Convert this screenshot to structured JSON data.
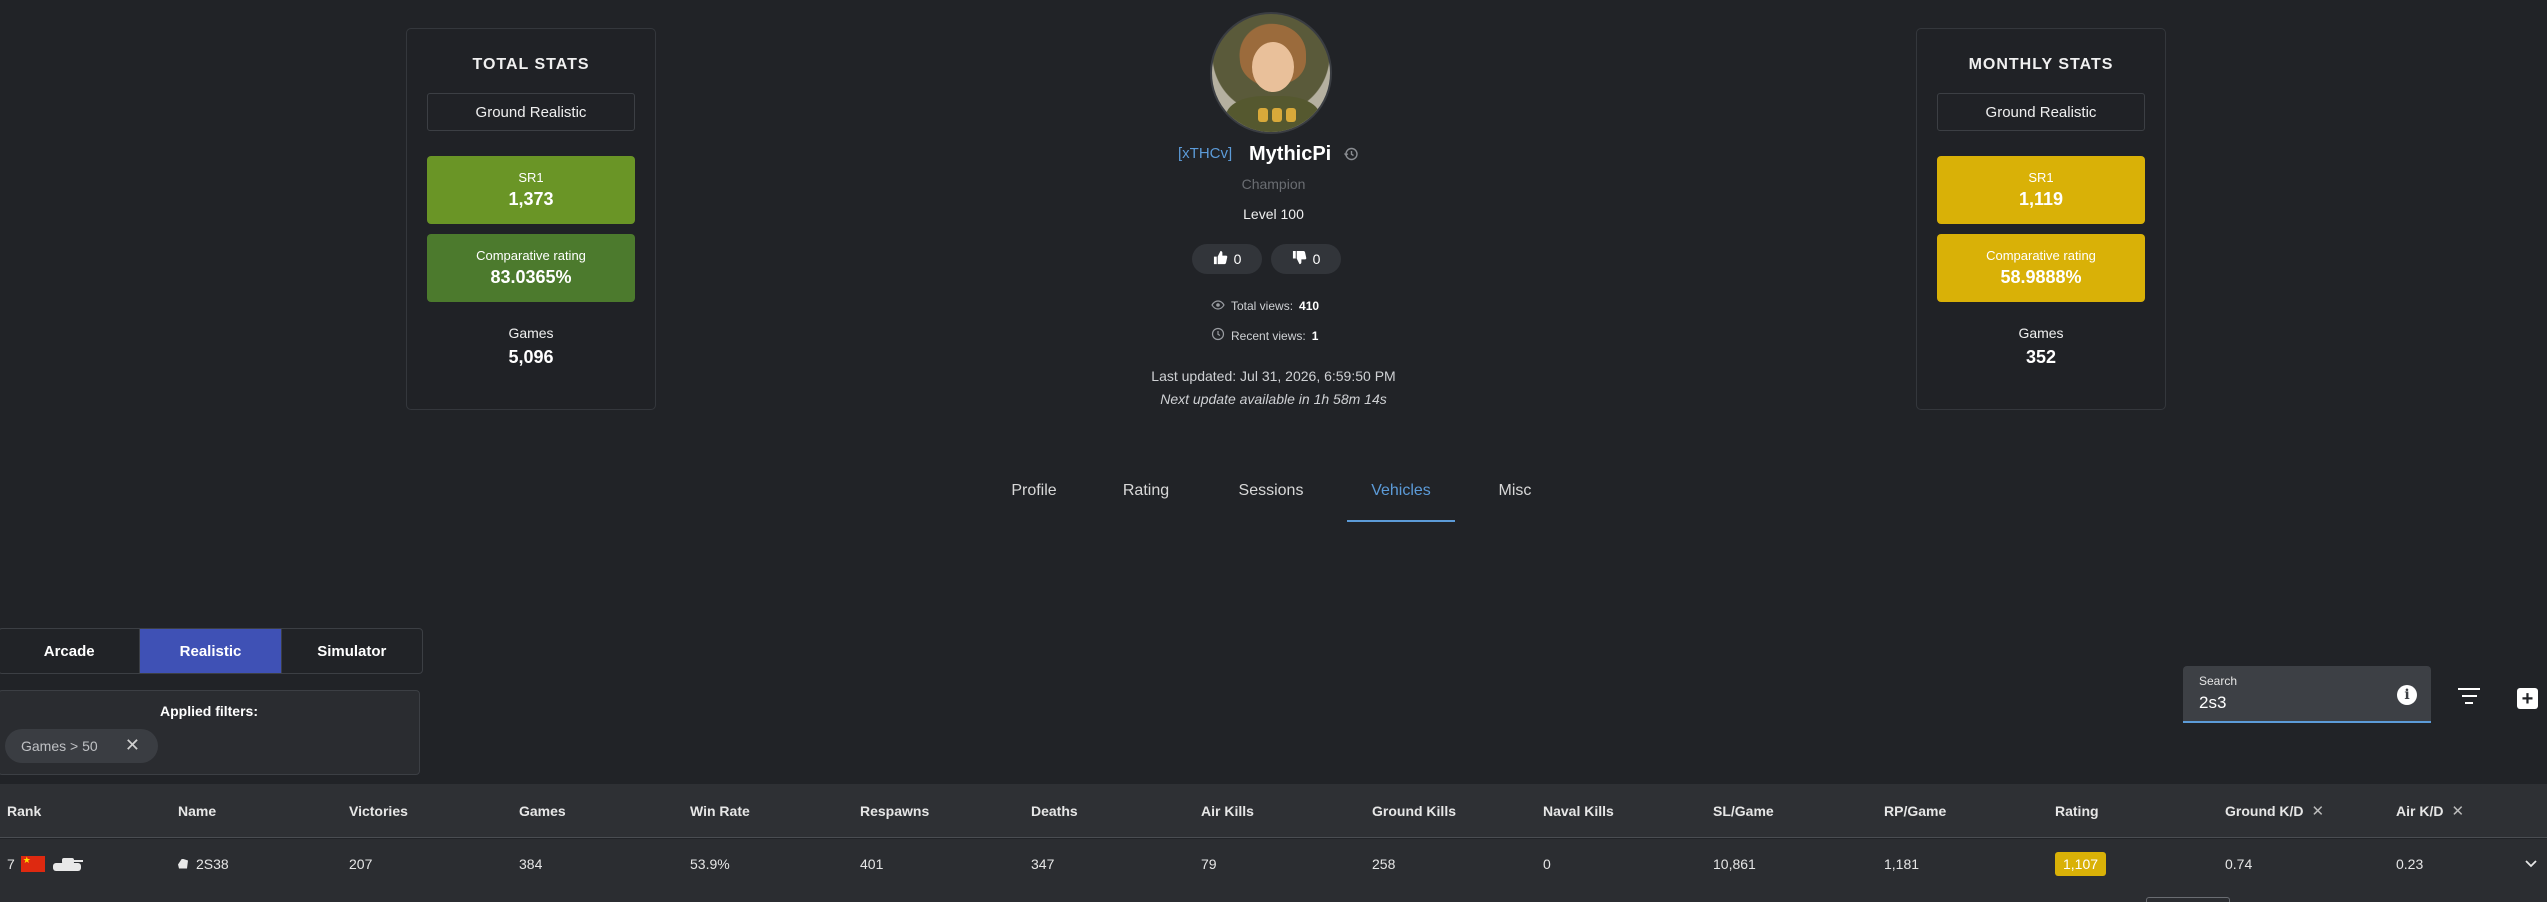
{
  "total_stats": {
    "title": "TOTAL STATS",
    "mode": "Ground Realistic",
    "sr1_label": "SR1",
    "sr1_value": "1,373",
    "comparative_label": "Comparative rating",
    "comparative_value": "83.0365%",
    "games_label": "Games",
    "games_value": "5,096",
    "colors": {
      "sr1": "#6a9526",
      "comparative": "#4c7a2d"
    }
  },
  "monthly_stats": {
    "title": "MONTHLY STATS",
    "mode": "Ground Realistic",
    "sr1_label": "SR1",
    "sr1_value": "1,119",
    "comparative_label": "Comparative rating",
    "comparative_value": "58.9888%",
    "games_label": "Games",
    "games_value": "352",
    "colors": {
      "sr1": "#d9b107",
      "comparative": "#d9b107"
    }
  },
  "profile": {
    "squadron": "[xTHCv]",
    "name": "MythicPi",
    "title": "Champion",
    "level": "Level 100",
    "likes": "0",
    "dislikes": "0",
    "total_views_label": "Total views:",
    "total_views": "410",
    "recent_views_label": "Recent views:",
    "recent_views": "1",
    "last_updated": "Last updated: Jul 31, 2026, 6:59:50 PM",
    "next_update": "Next update available in 1h 58m 14s"
  },
  "tabs": [
    {
      "label": "Profile",
      "active": false
    },
    {
      "label": "Rating",
      "active": false
    },
    {
      "label": "Sessions",
      "active": false
    },
    {
      "label": "Vehicles",
      "active": true
    },
    {
      "label": "Misc",
      "active": false
    }
  ],
  "mode_switch": {
    "options": [
      "Arcade",
      "Realistic",
      "Simulator"
    ],
    "selected": "Realistic"
  },
  "filters": {
    "title": "Applied filters:",
    "chips": [
      "Games > 50"
    ]
  },
  "search": {
    "label": "Search",
    "value": "2s3"
  },
  "table": {
    "columns": [
      "Rank",
      "Name",
      "Victories",
      "Games",
      "Win Rate",
      "Respawns",
      "Deaths",
      "Air Kills",
      "Ground Kills",
      "Naval Kills",
      "SL/Game",
      "RP/Game",
      "Rating",
      "Ground K/D",
      "Air K/D"
    ],
    "rows": [
      {
        "rank": "7",
        "name": "2S38",
        "victories": "207",
        "games": "384",
        "win_rate": "53.9%",
        "respawns": "401",
        "deaths": "347",
        "air_kills": "79",
        "ground_kills": "258",
        "naval_kills": "0",
        "sl_game": "10,861",
        "rp_game": "1,181",
        "rating": "1,107",
        "ground_kd": "0.74",
        "air_kd": "0.23"
      }
    ]
  },
  "icons": {
    "views": "eye-icon",
    "recent": "clock-icon",
    "history": "history-icon",
    "like": "thumbs-up-icon",
    "dislike": "thumbs-down-icon",
    "info": "info-icon",
    "filter": "filter-icon",
    "add": "add-icon",
    "expand": "chevron-down-icon"
  },
  "accent_color": "#5c9bd8",
  "active_mode_color": "#3f51b5"
}
